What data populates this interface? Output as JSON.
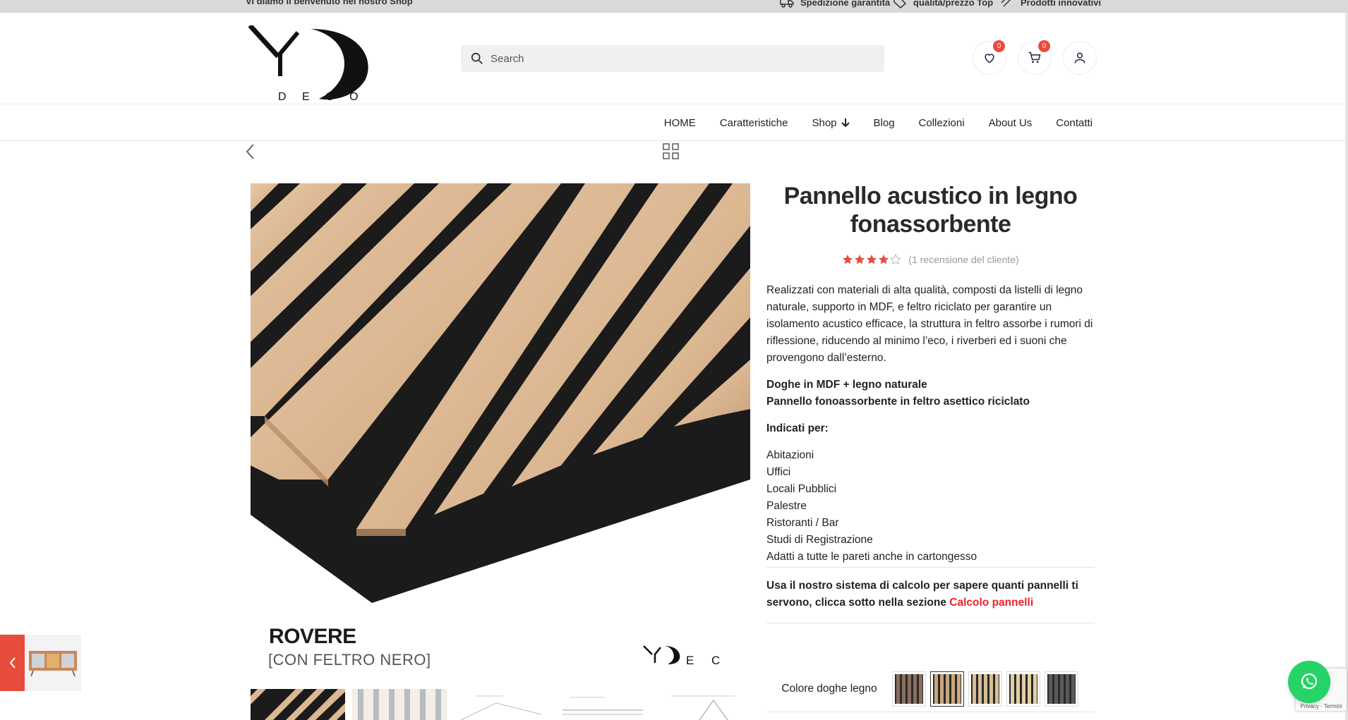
{
  "topbar": {
    "welcome": "Vi diamo il benvenuto nel nostro Shop",
    "perks": [
      "Spedizione garantita",
      "qualità/prezzo Top",
      "Prodotti innovativi"
    ]
  },
  "logo": {
    "letters": "YD",
    "sub": "DECO"
  },
  "search": {
    "placeholder": "Search"
  },
  "header_icons": {
    "wishlist_count": "0",
    "cart_count": "0"
  },
  "nav": {
    "items": [
      "HOME",
      "Caratteristiche",
      "Shop",
      "Blog",
      "Collezioni",
      "About Us",
      "Contatti"
    ]
  },
  "gallery": {
    "caption_title": "ROVERE",
    "caption_sub": "[CON FELTRO NERO]",
    "watermark": "DECO"
  },
  "product": {
    "title": "Pannello acustico in legno fonassorbente",
    "rating": 4,
    "rating_max": 5,
    "reviews_text": "(1 recensione del cliente)",
    "description": "Realizzati con materiali di alta qualità, composti da listelli di legno naturale,  supporto in MDF, e feltro riciclato per garantire un isolamento acustico efficace, la struttura in feltro assorbe i rumori di riflessione, riducendo al minimo l’eco, i riverberi ed i suoni che provengono dall’esterno.",
    "features": [
      "Doghe in MDF + legno naturale",
      "Pannello fonoassorbente in feltro asettico riciclato"
    ],
    "indicated_label": "Indicati per:",
    "uses": [
      "Abitazioni",
      "Uffici",
      "Locali Pubblici",
      "Palestre",
      "Ristoranti / Bar",
      "Studi di Registrazione",
      "Adatti a tutte le pareti anche in cartongesso"
    ],
    "calc_text": "Usa il nostro sistema di calcolo per sapere quanti pannelli ti servono, clicca sotto nella sezione ",
    "calc_link": "Calcolo pannelli",
    "color_label": "Colore doghe legno"
  },
  "colors": {
    "accent_red": "#e84c3d",
    "link_red": "#e8242a",
    "whatsapp": "#25d366",
    "swatches": [
      "#8b6f5e",
      "#c9a67c",
      "#d7bf95",
      "#e3cfa4",
      "#5a5a5a"
    ]
  },
  "recaptcha": {
    "text": "Privacy - Termini"
  }
}
